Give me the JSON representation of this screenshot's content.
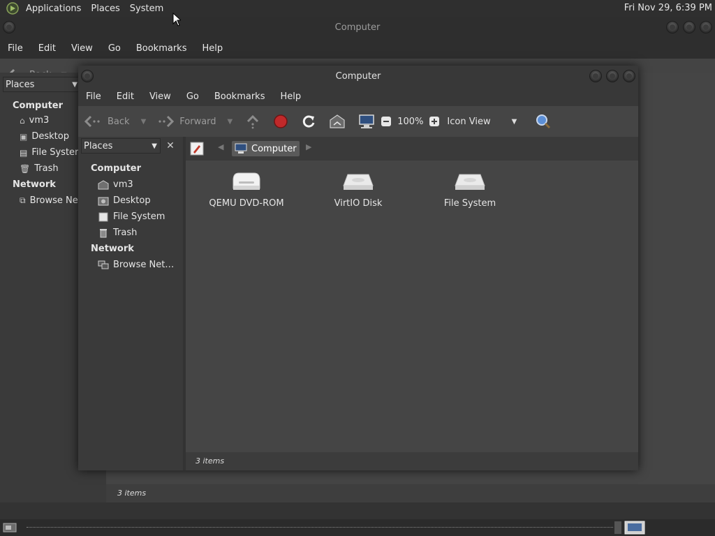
{
  "top_panel": {
    "menus": [
      "Applications",
      "Places",
      "System"
    ],
    "clock": "Fri Nov 29,  6:39 PM"
  },
  "bg_window": {
    "title": "Computer",
    "menus": [
      "File",
      "Edit",
      "View",
      "Go",
      "Bookmarks",
      "Help"
    ],
    "back_label": "Back",
    "places_label": "Places",
    "section_computer": "Computer",
    "items": [
      "vm3",
      "Desktop",
      "File Syster",
      "Trash"
    ],
    "section_network": "Network",
    "network_item": "Browse Ne",
    "status": "3 items"
  },
  "main_window": {
    "title": "Computer",
    "menus": [
      "File",
      "Edit",
      "View",
      "Go",
      "Bookmarks",
      "Help"
    ],
    "toolbar": {
      "back": "Back",
      "forward": "Forward",
      "zoom": "100%",
      "view_mode": "Icon View"
    },
    "sidebar": {
      "places_label": "Places",
      "section_computer": "Computer",
      "items": [
        "vm3",
        "Desktop",
        "File System",
        "Trash"
      ],
      "section_network": "Network",
      "network_item": "Browse Net…"
    },
    "path": {
      "current": "Computer"
    },
    "drives": [
      "QEMU DVD-ROM",
      "VirtIO Disk",
      "File System"
    ],
    "status": "3 items"
  },
  "colors": {
    "stop": "#c0292a",
    "accent_blue": "#5c8fd6"
  }
}
